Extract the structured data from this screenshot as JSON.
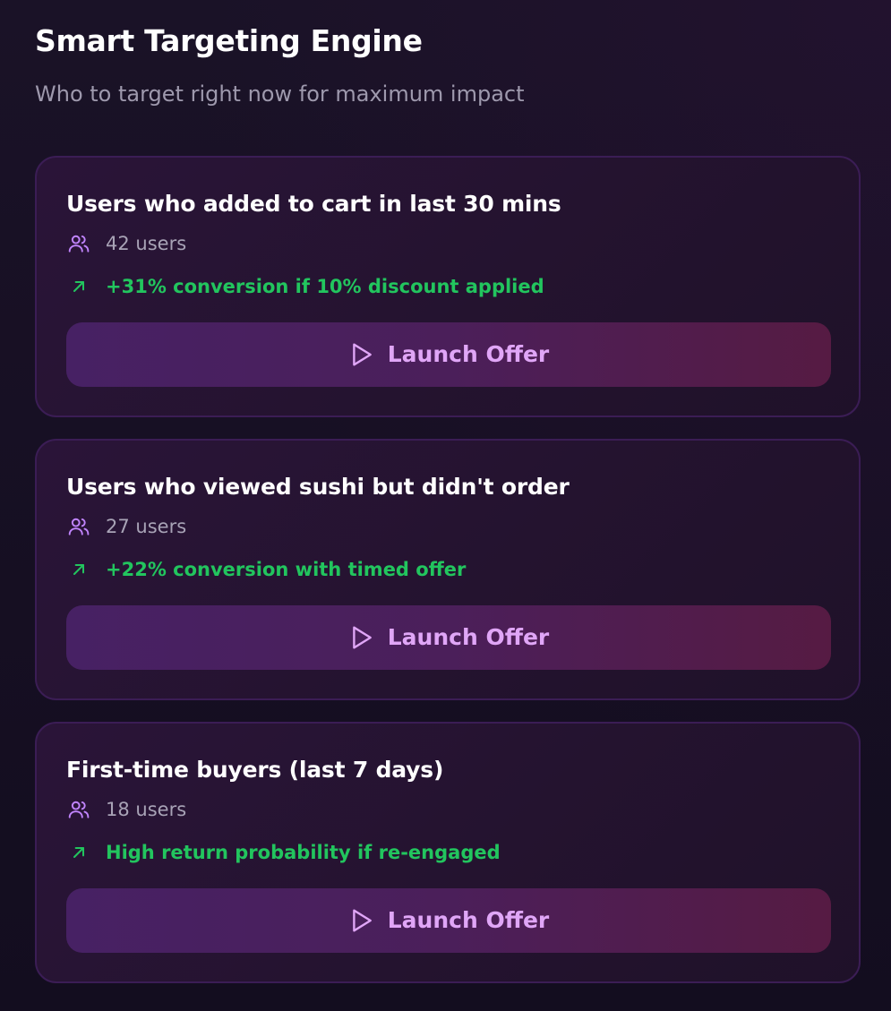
{
  "header": {
    "title": "Smart Targeting Engine",
    "subtitle": "Who to target right now for maximum impact"
  },
  "colors": {
    "background": "#130d1f",
    "card_border": "#3b1d55",
    "accent_purple": "#c084fc",
    "positive_green": "#22c55e",
    "button_text": "#e0a6f7"
  },
  "icons": {
    "users": "users-icon",
    "trend": "arrow-up-right-icon",
    "launch": "play-icon"
  },
  "segments": [
    {
      "title": "Users who added to cart in last 30 mins",
      "users": "42 users",
      "insight": "+31% conversion if 10% discount applied",
      "action_label": "Launch Offer"
    },
    {
      "title": "Users who viewed sushi but didn't order",
      "users": "27 users",
      "insight": "+22% conversion with timed offer",
      "action_label": "Launch Offer"
    },
    {
      "title": "First-time buyers (last 7 days)",
      "users": "18 users",
      "insight": "High return probability if re-engaged",
      "action_label": "Launch Offer"
    }
  ]
}
